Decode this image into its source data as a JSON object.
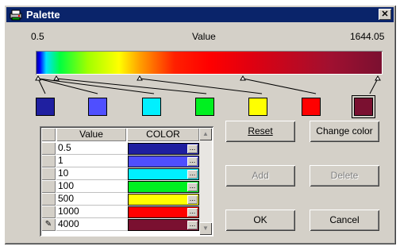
{
  "window": {
    "title": "Palette",
    "close_glyph": "✕",
    "app_icon": "printer-icon"
  },
  "scale": {
    "min_label": "0.5",
    "center_label": "Value",
    "max_label": "1644.05"
  },
  "swatches": [
    {
      "color": "#1f1fa0"
    },
    {
      "color": "#4f4fff"
    },
    {
      "color": "#00f0ff"
    },
    {
      "color": "#00f020"
    },
    {
      "color": "#ffff00"
    },
    {
      "color": "#ff0000"
    },
    {
      "color": "#7a1030",
      "selected": true
    }
  ],
  "table": {
    "columns": [
      "Value",
      "COLOR"
    ],
    "rows": [
      {
        "value": "0.5",
        "color": "#1f1fa0"
      },
      {
        "value": "1",
        "color": "#4f4fff"
      },
      {
        "value": "10",
        "color": "#00f0ff"
      },
      {
        "value": "100",
        "color": "#00f020"
      },
      {
        "value": "500",
        "color": "#ffff00"
      },
      {
        "value": "1000",
        "color": "#ff0000"
      },
      {
        "value": "4000",
        "color": "#7a1030",
        "editing": true
      }
    ],
    "ellipsis": "...",
    "edit_glyph": "✎"
  },
  "buttons": {
    "reset": "Reset",
    "change_color": "Change color",
    "add": "Add",
    "delete": "Delete",
    "ok": "OK",
    "cancel": "Cancel"
  }
}
